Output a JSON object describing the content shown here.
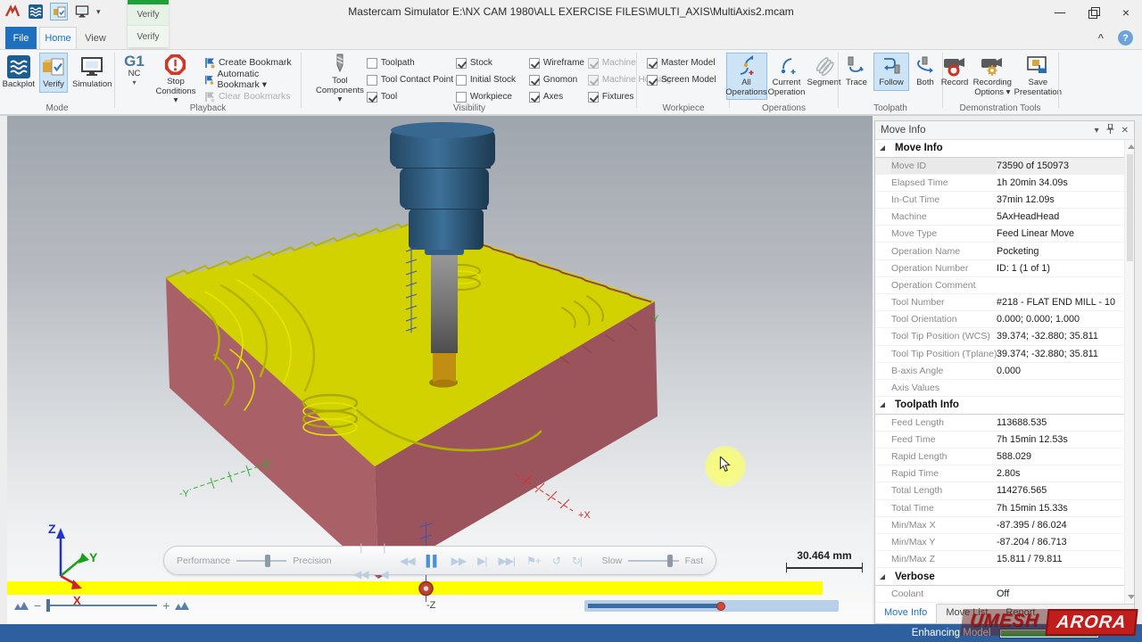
{
  "window": {
    "title": "Mastercam Simulator  E:\\NX CAM 1980\\ALL EXERCISE FILES\\MULTI_AXIS\\MultiAxis2.mcam",
    "close": "×",
    "ribbon_collapse": "^",
    "help": "?"
  },
  "verify_popup": {
    "title": "Verify",
    "item": "Verify"
  },
  "tabs": {
    "file": "File",
    "home": "Home",
    "view": "View"
  },
  "ribbon": {
    "mode": {
      "label": "Mode",
      "backplot": "Backplot",
      "verify": "Verify",
      "simulation": "Simulation"
    },
    "playback": {
      "label": "Playback",
      "nc_big": "G1",
      "nc_label": "NC",
      "nc_caret": "▾",
      "stop_line1": "Stop",
      "stop_line2": "Conditions ▾",
      "bookmarks": [
        {
          "label": "Create Bookmark",
          "name": "create-bookmark-button"
        },
        {
          "label": "Automatic Bookmark ▾",
          "name": "automatic-bookmark-button"
        },
        {
          "label": "Clear Bookmarks",
          "name": "clear-bookmarks-button",
          "disabled": true
        }
      ]
    },
    "visibility": {
      "label": "Visibility",
      "tc_line1": "Tool",
      "tc_line2": "Components ▾",
      "checkboxes": [
        {
          "label": "Toolpath",
          "checked": false,
          "name": "toolpath-checkbox"
        },
        {
          "label": "Tool Contact Point",
          "checked": false,
          "name": "tool-contact-point-checkbox"
        },
        {
          "label": "Tool",
          "checked": true,
          "name": "tool-checkbox"
        },
        {
          "label": "Stock",
          "checked": true,
          "name": "stock-checkbox"
        },
        {
          "label": "Initial Stock",
          "checked": false,
          "name": "initial-stock-checkbox"
        },
        {
          "label": "Workpiece",
          "checked": false,
          "name": "workpiece-checkbox"
        },
        {
          "label": "Wireframe",
          "checked": true,
          "name": "wireframe-checkbox"
        },
        {
          "label": "Gnomon",
          "checked": true,
          "name": "gnomon-checkbox"
        },
        {
          "label": "Axes",
          "checked": true,
          "name": "axes-checkbox"
        },
        {
          "label": "Machine",
          "checked": true,
          "disabled": true,
          "name": "machine-checkbox"
        },
        {
          "label": "Machine Housing",
          "checked": true,
          "disabled": true,
          "name": "machine-housing-checkbox"
        },
        {
          "label": "Fixtures",
          "checked": true,
          "name": "fixtures-checkbox"
        }
      ]
    },
    "workpiece": {
      "label": "Workpiece",
      "checkboxes": [
        {
          "label": "Master Model",
          "checked": true,
          "name": "master-model-checkbox"
        },
        {
          "label": "Screen Model",
          "checked": true,
          "name": "screen-model-checkbox"
        }
      ]
    },
    "operations": {
      "label": "Operations",
      "all1": "All",
      "all2": "Operations",
      "cur1": "Current",
      "cur2": "Operation",
      "segment": "Segment"
    },
    "toolpath": {
      "label": "Toolpath",
      "trace": "Trace",
      "follow": "Follow",
      "both": "Both"
    },
    "demo": {
      "label": "Demonstration Tools",
      "record": "Record",
      "rec1": "Recording",
      "rec2": "Options ▾",
      "save1": "Save",
      "save2": "Presentation"
    }
  },
  "viewport": {
    "scale_label": "30.464 mm",
    "axis": {
      "neg_y": "-Y",
      "pos_x": "+X",
      "neg_z": "-Z",
      "edge_y": "Y",
      "gx": "X",
      "gy": "Y",
      "gz": "Z"
    },
    "playbar": {
      "performance": "Performance",
      "precision": "Precision",
      "slow": "Slow",
      "fast": "Fast",
      "buttons": [
        {
          "glyph": "|◀◀",
          "name": "go-to-start-button"
        },
        {
          "glyph": "|◀",
          "name": "previous-operation-button"
        },
        {
          "glyph": "◀◀",
          "name": "step-backward-button"
        },
        {
          "glyph": "▌▌",
          "name": "pause-button",
          "active": true
        },
        {
          "glyph": "▶▶",
          "name": "play-button"
        },
        {
          "glyph": "▶|",
          "name": "next-operation-button"
        },
        {
          "glyph": "▶▶|",
          "name": "go-to-end-button"
        },
        {
          "glyph": "⚑+",
          "name": "bookmark-button"
        },
        {
          "glyph": "↺",
          "name": "loop-backward-button"
        },
        {
          "glyph": "↻|",
          "name": "loop-forward-button"
        }
      ]
    },
    "zoom_minus": "−",
    "zoom_plus": "+"
  },
  "panel": {
    "title": "Move Info",
    "rows": [
      {
        "label": "Move Info",
        "value": "",
        "header": true
      },
      {
        "label": "Move ID",
        "value": "73590 of 150973",
        "highlight": true
      },
      {
        "label": "Elapsed Time",
        "value": "1h 20min 34.09s"
      },
      {
        "label": "In-Cut Time",
        "value": "37min 12.09s"
      },
      {
        "label": "Machine",
        "value": "5AxHeadHead"
      },
      {
        "label": "Move Type",
        "value": "Feed Linear Move"
      },
      {
        "label": "Operation Name",
        "value": "Pocketing"
      },
      {
        "label": "Operation Number",
        "value": "ID: 1 (1 of 1)"
      },
      {
        "label": "Operation Comment",
        "value": ""
      },
      {
        "label": "Tool Number",
        "value": "#218 - FLAT END MILL - 10"
      },
      {
        "label": "Tool Orientation",
        "value": "0.000; 0.000; 1.000"
      },
      {
        "label": "Tool Tip Position (WCS)",
        "value": "39.374; -32.880; 35.811"
      },
      {
        "label": "Tool Tip Position (Tplane)",
        "value": "39.374; -32.880; 35.811"
      },
      {
        "label": "B-axis Angle",
        "value": "0.000"
      },
      {
        "label": "Axis Values",
        "value": ""
      },
      {
        "label": "Toolpath Info",
        "value": "",
        "header": true
      },
      {
        "label": "Feed Length",
        "value": "113688.535"
      },
      {
        "label": "Feed Time",
        "value": "7h 15min 12.53s"
      },
      {
        "label": "Rapid Length",
        "value": "588.029"
      },
      {
        "label": "Rapid Time",
        "value": "2.80s"
      },
      {
        "label": "Total Length",
        "value": "114276.565"
      },
      {
        "label": "Total Time",
        "value": "7h 15min 15.33s"
      },
      {
        "label": "Min/Max X",
        "value": "-87.395 / 86.024"
      },
      {
        "label": "Min/Max Y",
        "value": "-87.204 / 86.713"
      },
      {
        "label": "Min/Max Z",
        "value": "15.811 / 79.811"
      },
      {
        "label": "Verbose",
        "value": "",
        "header": true
      },
      {
        "label": "Coolant",
        "value": "Off"
      }
    ],
    "tabs": [
      {
        "label": "Move Info",
        "active": true,
        "name": "tab-move-info"
      },
      {
        "label": "Move List",
        "name": "tab-move-list"
      },
      {
        "label": "Report",
        "name": "tab-report"
      }
    ]
  },
  "statusbar": {
    "text": "Enhancing Model",
    "percent": "100%"
  },
  "watermark": {
    "first": "UMESH",
    "second": "ARORA"
  }
}
